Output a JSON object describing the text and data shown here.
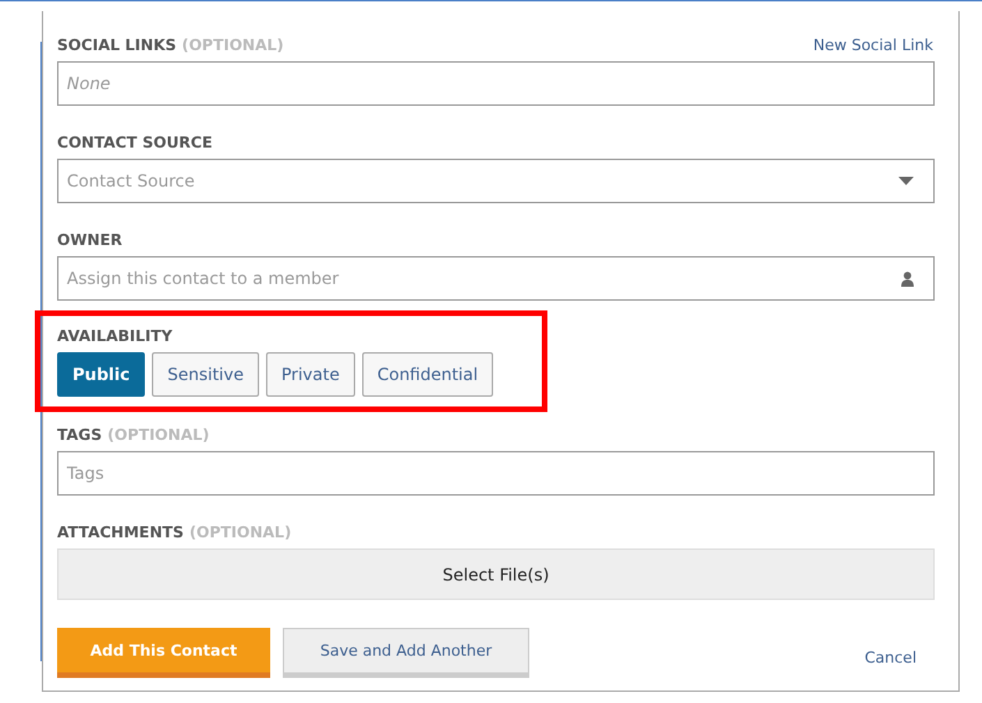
{
  "fields": [
    {
      "kind": "text",
      "label": "SOCIAL LINKS",
      "note": "(OPTIONAL)",
      "link": "New Social Link",
      "placeholder": "None",
      "italic": true
    },
    {
      "kind": "select",
      "label": "CONTACT SOURCE",
      "placeholder": "Contact Source"
    },
    {
      "kind": "person",
      "label": "OWNER",
      "placeholder": "Assign this contact to a member"
    },
    {
      "kind": "choice",
      "label": "AVAILABILITY",
      "highlighted": true,
      "options": [
        {
          "label": "Public",
          "selected": true
        },
        {
          "label": "Sensitive",
          "selected": false
        },
        {
          "label": "Private",
          "selected": false
        },
        {
          "label": "Confidential",
          "selected": false
        }
      ]
    },
    {
      "kind": "text",
      "label": "TAGS",
      "note": "(OPTIONAL)",
      "placeholder": "Tags"
    },
    {
      "kind": "file",
      "label": "ATTACHMENTS",
      "note": "(OPTIONAL)",
      "button": "Select File(s)"
    }
  ],
  "actions": {
    "primary": "Add This Contact",
    "secondary": "Save and Add Another",
    "cancel": "Cancel"
  }
}
